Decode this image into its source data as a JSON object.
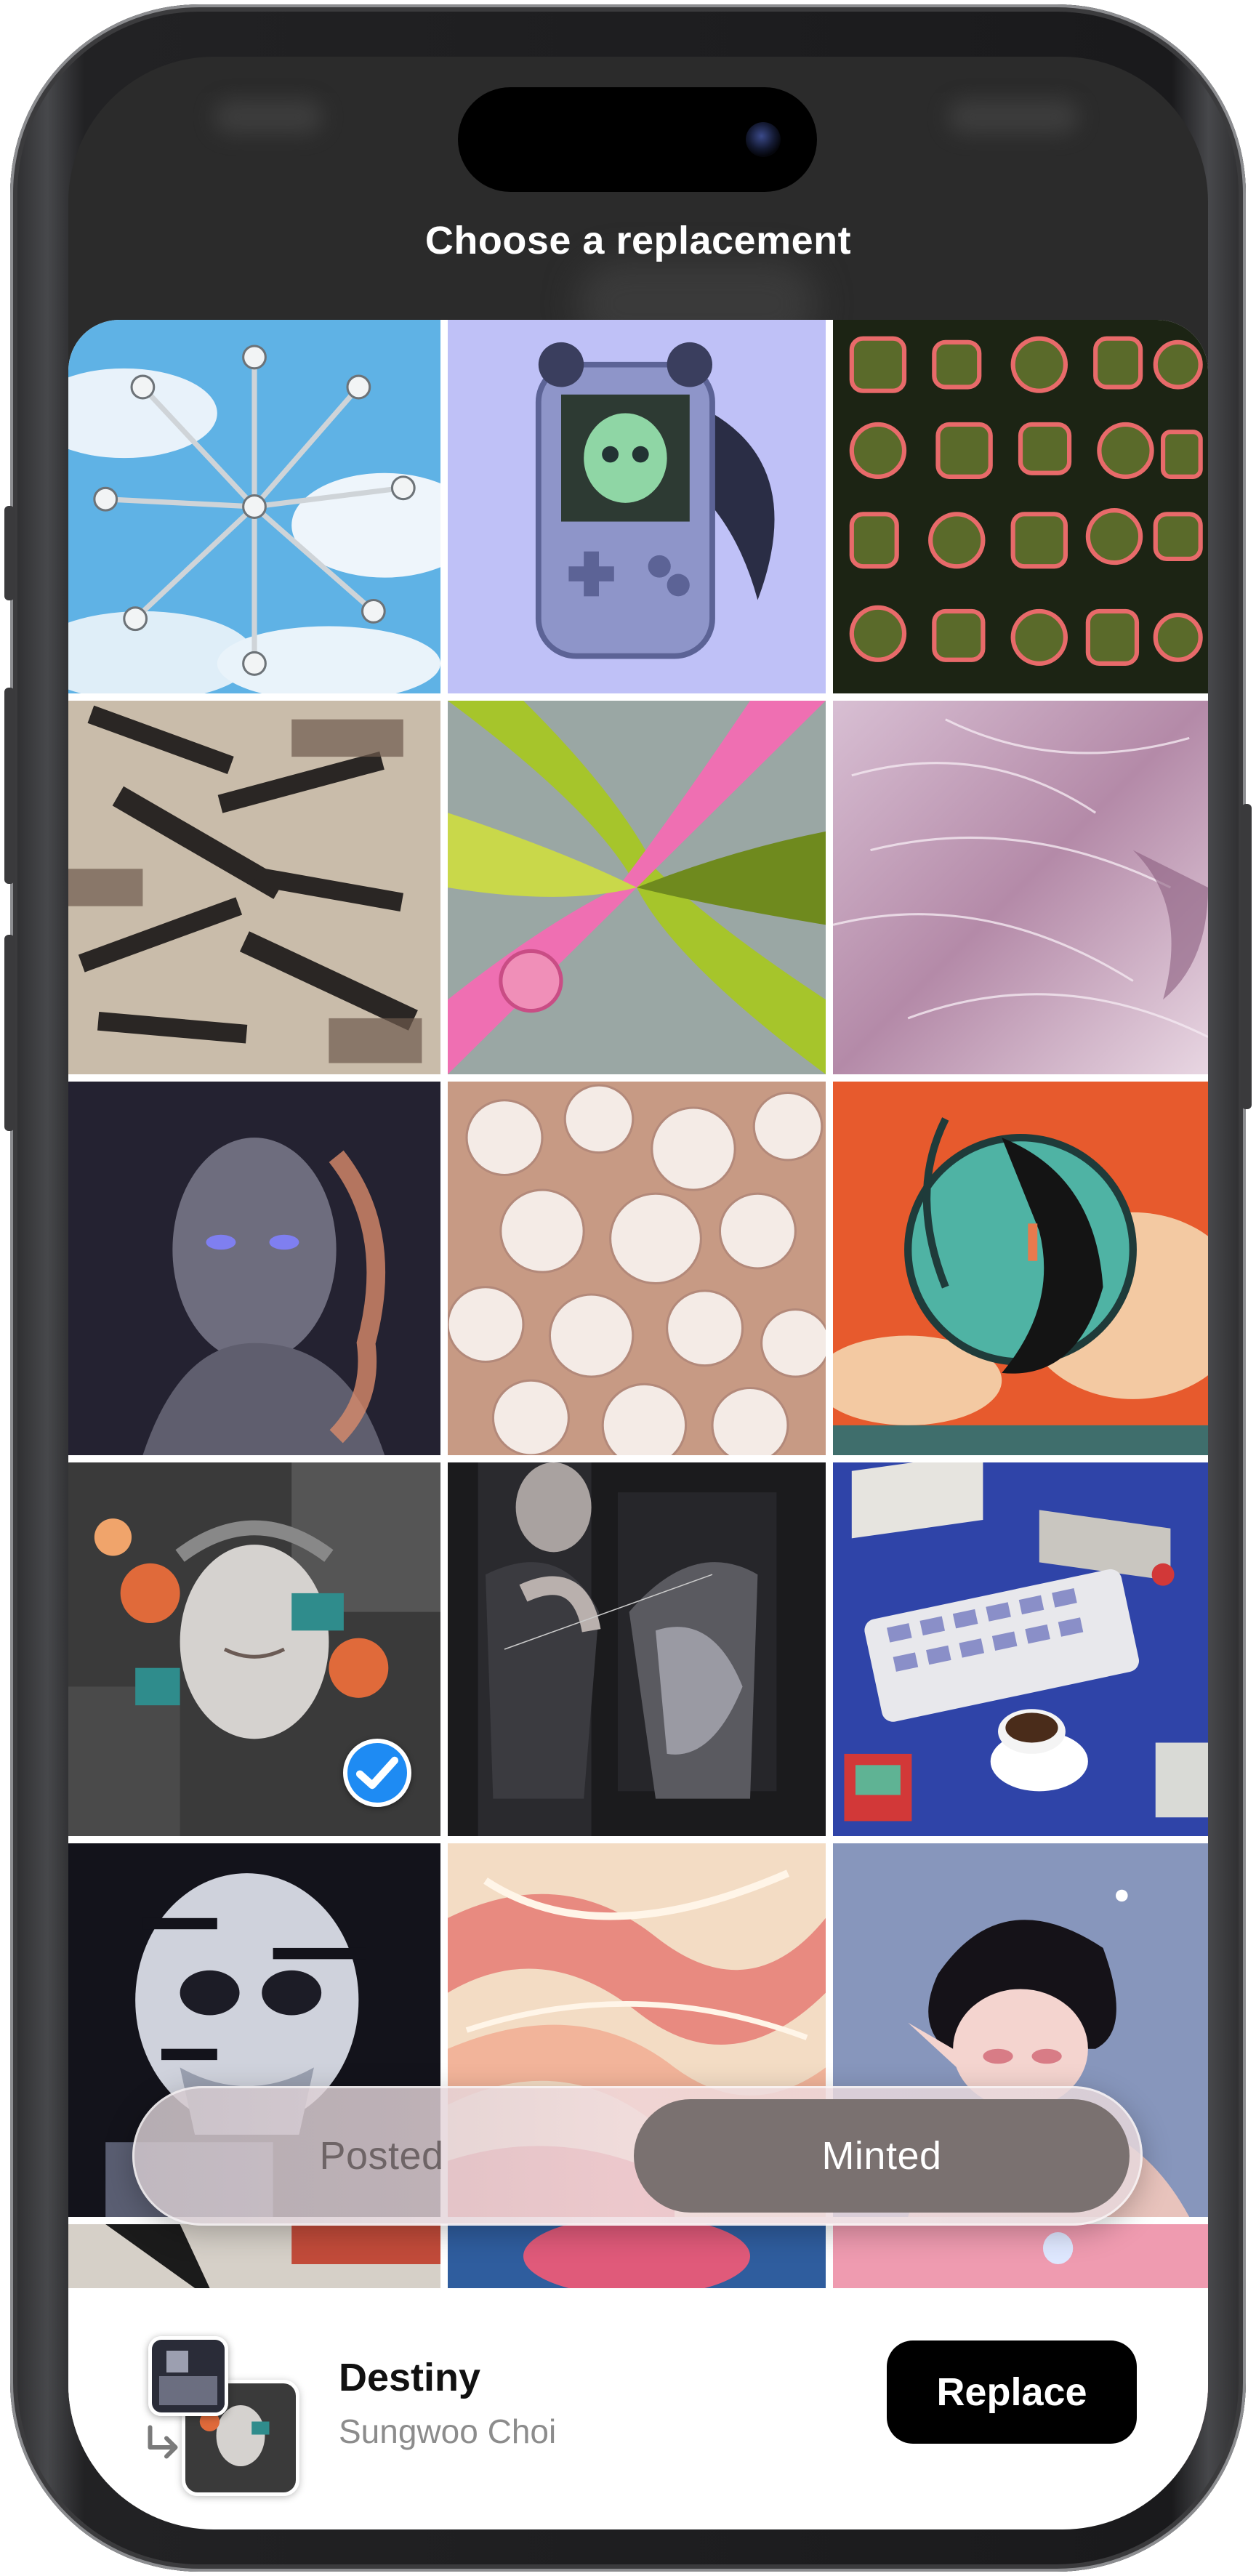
{
  "sheet": {
    "title": "Choose a replacement"
  },
  "grid": {
    "tiles": [
      {
        "name": "tile-chrome-stars-sky",
        "selected": false
      },
      {
        "name": "tile-pixel-handheld-toy",
        "selected": false
      },
      {
        "name": "tile-pink-pattern",
        "selected": false
      },
      {
        "name": "tile-glitch-rifles",
        "selected": false
      },
      {
        "name": "tile-green-pink-swirl",
        "selected": false
      },
      {
        "name": "tile-lilac-fur",
        "selected": false
      },
      {
        "name": "tile-blurred-figure",
        "selected": false
      },
      {
        "name": "tile-meringues",
        "selected": false
      },
      {
        "name": "tile-teal-creature",
        "selected": false
      },
      {
        "name": "tile-collage-face",
        "selected": true
      },
      {
        "name": "tile-dark-portrait",
        "selected": false
      },
      {
        "name": "tile-isometric-desk",
        "selected": false
      },
      {
        "name": "tile-glitch-skull",
        "selected": false
      },
      {
        "name": "tile-peach-waves",
        "selected": false
      },
      {
        "name": "tile-elf-girl",
        "selected": false
      }
    ]
  },
  "segmented_control": {
    "options": [
      "Posted",
      "Minted"
    ],
    "selected": "Minted"
  },
  "bottom_bar": {
    "title": "Destiny",
    "artist": "Sungwoo Choi",
    "action_label": "Replace"
  },
  "icons": {
    "selected_check": "check-circle-icon",
    "replace_arrow": "return-arrow-icon"
  },
  "colors": {
    "accent_check": "#1e8bf3",
    "segment_selected": "#7a7170",
    "button_bg": "#000000"
  }
}
